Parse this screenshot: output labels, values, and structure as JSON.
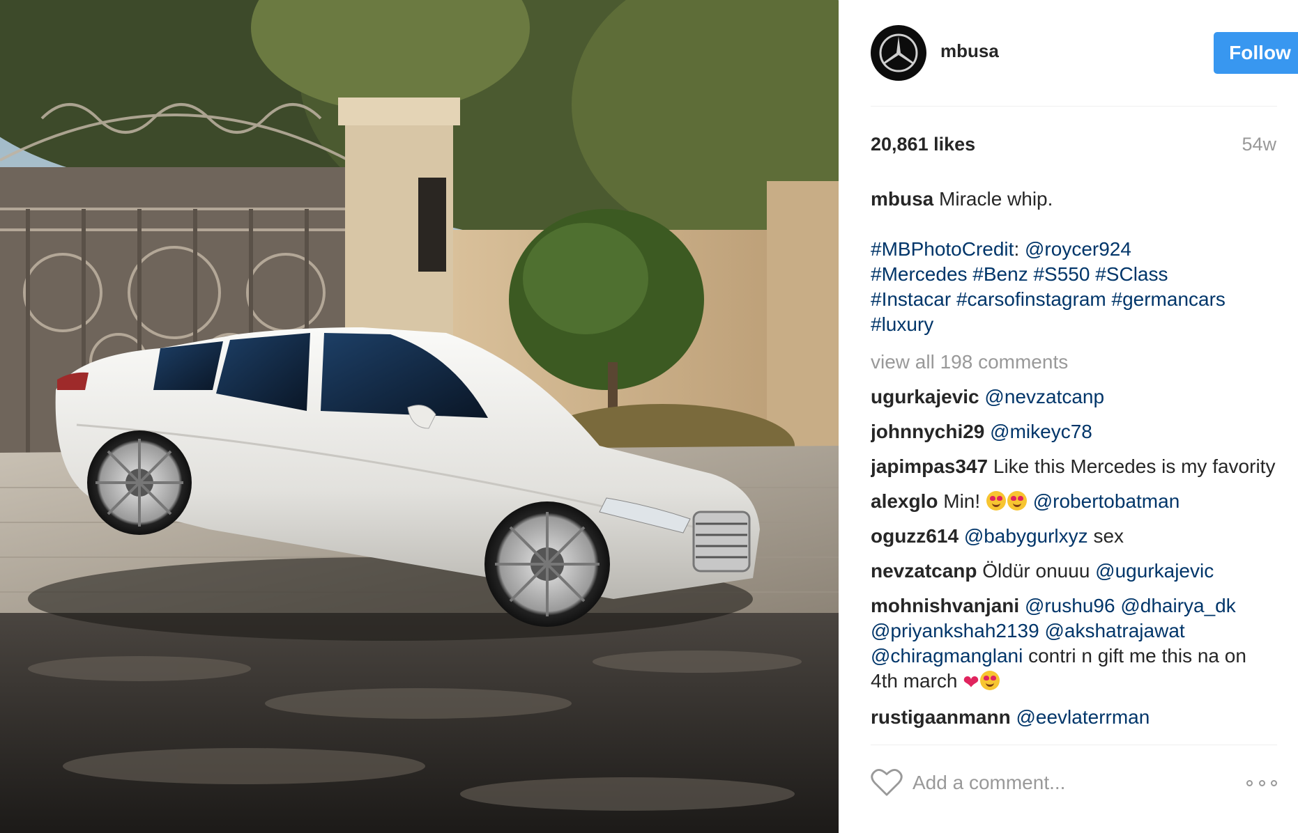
{
  "post": {
    "username": "mbusa",
    "follow_label": "Follow",
    "likes": "20,861 likes",
    "age": "54w",
    "caption": {
      "text": "Miracle whip.",
      "tag_lines": [
        [
          "#MBPhotoCredit",
          ":",
          "@roycer924"
        ],
        [
          "#Mercedes",
          "#Benz",
          "#S550",
          "#SClass"
        ],
        [
          "#Instacar",
          "#carsofinstagram",
          "#germancars"
        ],
        [
          "#luxury"
        ]
      ]
    },
    "view_all": "view all 198 comments",
    "comments": [
      {
        "user": "ugurkajevic",
        "mention": "@nevzatcanp"
      },
      {
        "user": "johnnychi29",
        "mention": "@mikeyc78"
      },
      {
        "user": "japimpas347",
        "text": "Like this Mercedes is my favority"
      },
      {
        "user": "alexglo",
        "text": "Min!",
        "mention": "@robertobatman"
      },
      {
        "user": "oguzz614",
        "mention": "@babygurlxyz",
        "text_after": "sex"
      },
      {
        "user": "nevzatcanp",
        "text": "Öldür onuuu",
        "mention": "@ugurkajevic"
      },
      {
        "user": "mohnishvanjani",
        "mentions": [
          "@rushu96",
          "@dhairya_dk",
          "@priyankshah2139",
          "@akshatrajawat",
          "@chiragmanglani"
        ],
        "text_after": "contri n gift me this na on 4th march"
      },
      {
        "user": "rustigaanmann",
        "mention": "@eevlaterrman"
      }
    ],
    "add_comment_placeholder": "Add a comment..."
  },
  "colors": {
    "follow_button": "#3897f0",
    "link": "#003569",
    "muted": "#999999",
    "text": "#262626"
  },
  "icons": {
    "avatar": "mercedes-star-logo",
    "like": "heart-outline-icon",
    "more": "ellipsis-icon"
  }
}
